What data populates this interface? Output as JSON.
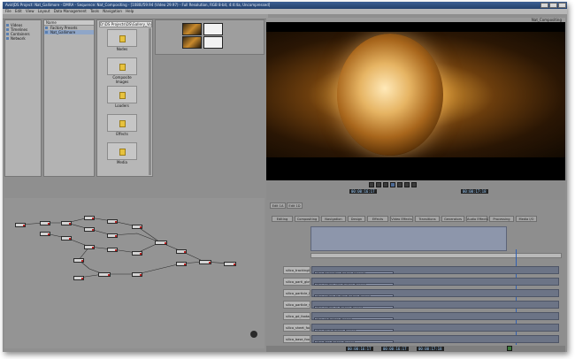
{
  "app": {
    "title": "Avid|DS Project: Nat_Gallimore - DMRA - Sequence: Nat_Compositing - [1080i/59.94 (Video 29.97) - Full Resolution, RGB 8-bit, 4:4:4a, Uncompressed]"
  },
  "menu": [
    "File",
    "Edit",
    "View",
    "Layout",
    "Data Management",
    "Tools",
    "Navigation",
    "Help"
  ],
  "project_tree": {
    "items": [
      "Videos",
      "Timelines",
      "Containers",
      "Network"
    ]
  },
  "browser": {
    "header": "Name",
    "items": [
      "Factory Presets",
      "Nat_Gallimore"
    ]
  },
  "folder_grid": {
    "path": "D:\\DS Projects\\DS\\Gallery_Vol",
    "items": [
      "Nodes",
      "Composite Images",
      "Loaders",
      "Effects",
      "Media"
    ]
  },
  "viewer": {
    "label": "Nat_Compositing",
    "timecode_left": "00:00:16:17",
    "timecode_right": "00:00:17:18"
  },
  "timeline": {
    "tabs": [
      "Editing",
      "Compositing",
      "Navigation",
      "Design",
      "Effects",
      "Video Effects",
      "Transitions",
      "Generators",
      "Audio Effects",
      "Processing",
      "Media I/O"
    ],
    "panel_tabs": [
      "Edit 1A",
      "Edit 1D"
    ],
    "tracks": [
      {
        "label": "silico_trackingline",
        "clip": "silico_Trackingline_Footage_Timecode"
      },
      {
        "label": "silico_parti_glow",
        "clip": "silico_particle_glow_Footage_Encased"
      },
      {
        "label": "silico_particle_trk",
        "clip": "silico_particle_trk_New_Footage_Encased"
      },
      {
        "label": "silico_particle_sp",
        "clip": "silico_particle_sp_Footage_Encased"
      },
      {
        "label": "silico_gd_footage",
        "clip": "silico_gd_Footage_Encased"
      },
      {
        "label": "silico_sheet_footage",
        "clip": "silico_Sheet_Footage_Encased"
      },
      {
        "label": "silico_base_footage",
        "clip": "silico_Base_Footage_Encased"
      }
    ],
    "status_timecodes": [
      "00:00:16:17",
      "00:00:16:17",
      "00:00:17:18"
    ]
  },
  "colors": {
    "accent": "#2d4f86",
    "panel": "#a9a9a9",
    "viewer_bg": "#000000",
    "track": "#6c7486"
  }
}
